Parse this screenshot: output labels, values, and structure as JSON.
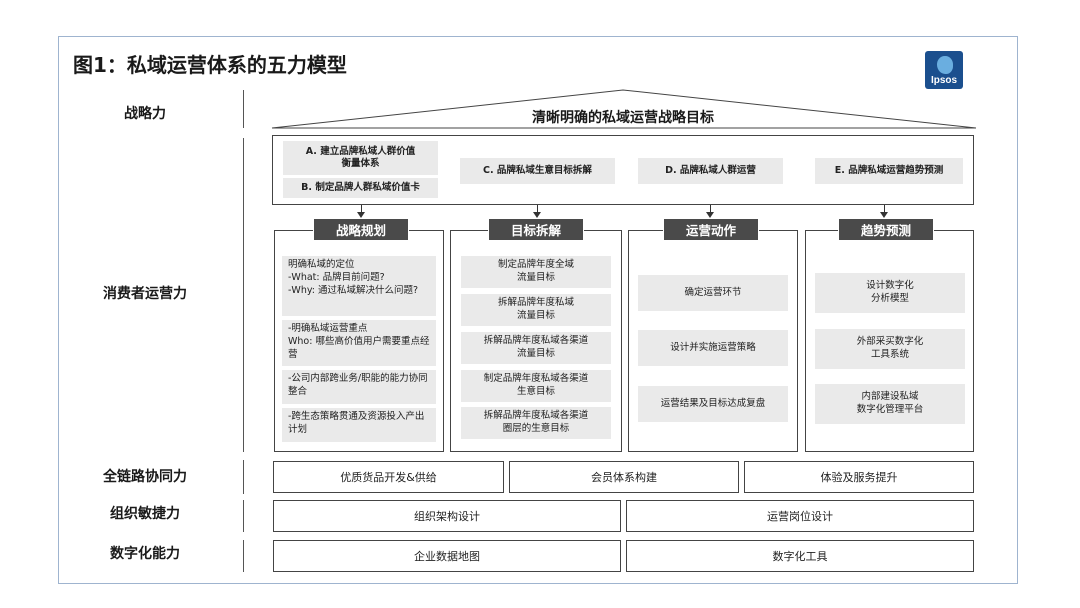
{
  "title": "图1：私域运营体系的五力模型",
  "logo": {
    "text": "Ipsos"
  },
  "row_labels": {
    "strategy": "战略力",
    "consumer_ops": "消费者运营力",
    "full_chain": "全链路协同力",
    "org_agility": "组织敏捷力",
    "digital": "数字化能力"
  },
  "roof_title": "清晰明确的私域运营战略目标",
  "top_items": {
    "a": "A. 建立品牌私域人群价值\n衡量体系",
    "b": "B. 制定品牌人群私域价值卡",
    "c": "C. 品牌私域生意目标拆解",
    "d": "D. 品牌私域人群运营",
    "e": "E. 品牌私域运营趋势预测"
  },
  "columns": [
    {
      "header": "战略规划",
      "items": [
        "明确私域的定位\n-What: 品牌目前问题?\n-Why: 通过私域解决什么问题?",
        "-明确私域运营重点\nWho: 哪些高价值用户需要重点经营",
        "-公司内部跨业务/职能的能力协同整合",
        "-跨生态策略贯通及资源投入产出计划"
      ]
    },
    {
      "header": "目标拆解",
      "items": [
        "制定品牌年度全域\n流量目标",
        "拆解品牌年度私域\n流量目标",
        "拆解品牌年度私域各渠道\n流量目标",
        "制定品牌年度私域各渠道\n生意目标",
        "拆解品牌年度私域各渠道\n圈层的生意目标"
      ]
    },
    {
      "header": "运营动作",
      "items": [
        "确定运营环节",
        "设计并实施运营策略",
        "运营结果及目标达成复盘"
      ]
    },
    {
      "header": "趋势预测",
      "items": [
        "设计数字化\n分析模型",
        "外部采买数字化\n工具系统",
        "内部建设私域\n数字化管理平台"
      ]
    }
  ],
  "full_chain": [
    "优质货品开发&供给",
    "会员体系构建",
    "体验及服务提升"
  ],
  "org_agility": [
    "组织架构设计",
    "运营岗位设计"
  ],
  "digital": [
    "企业数据地图",
    "数字化工具"
  ]
}
